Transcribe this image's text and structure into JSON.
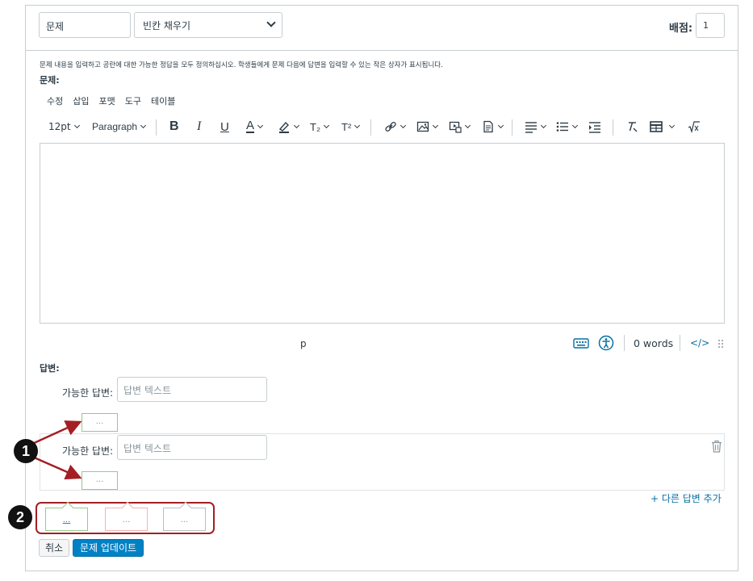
{
  "header": {
    "title_value": "문제",
    "question_type": "빈칸 채우기",
    "points_label": "배점:",
    "points_value": "1"
  },
  "instructions": "문제 내용을 입력하고 공란에 대한 가능한 정답을 모두 정의하십시오. 학생들에게 문제 다음에 답변을 입력할 수 있는 작은 상자가 표시됩니다.",
  "question_label": "문제:",
  "menu": [
    "수정",
    "삽입",
    "포맷",
    "도구",
    "테이블"
  ],
  "toolbar": {
    "font_size": "12pt",
    "block_format": "Paragraph",
    "bold": "B",
    "italic": "I",
    "underline": "U",
    "text_color": "A",
    "subscript": "T₂",
    "superscript": "T²"
  },
  "statusbar": {
    "path": "p",
    "word_count": "0 words",
    "html_toggle": "</>"
  },
  "answers": {
    "label": "답변:",
    "rows": [
      {
        "label": "가능한 답변:",
        "placeholder": "답변 텍스트",
        "tag": "..."
      },
      {
        "label": "가능한 답변:",
        "placeholder": "답변 텍스트",
        "tag": "..."
      }
    ],
    "add_label": "+ 다른 답변 추가"
  },
  "legend": {
    "tags": [
      "...",
      "...",
      "..."
    ]
  },
  "callouts": [
    "1",
    "2"
  ],
  "buttons": {
    "cancel": "취소",
    "update": "문제 업데이트"
  },
  "colors": {
    "accent_blue": "#0081c6",
    "link_blue": "#0770a3",
    "callout_red": "#a31f24",
    "tag_green": "#94c990",
    "tag_red": "#f2b3b1",
    "tag_gray": "#b8bec4"
  }
}
